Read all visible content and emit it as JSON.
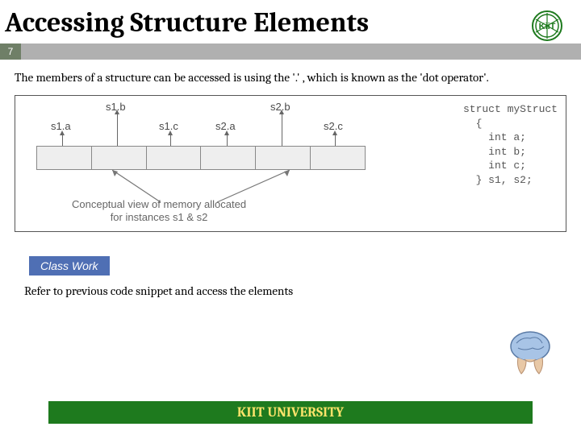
{
  "title": "Accessing Structure Elements",
  "page_number": "7",
  "intro": "The members of a structure can be accessed is using the '.' , which is known as the 'dot operator'.",
  "diagram": {
    "labels": [
      "s1.a",
      "s1.b",
      "s1.c",
      "s2.a",
      "s2.b",
      "s2.c"
    ],
    "caption_line1": "Conceptual view of memory allocated",
    "caption_line2": "for instances s1 & s2",
    "code": "struct myStruct\n  {\n    int a;\n    int b;\n    int c;\n  } s1, s2;"
  },
  "class_work_label": "Class Work",
  "refer_text": "Refer to previous code snippet and access the elements",
  "footer": "KIIT UNIVERSITY",
  "logo_text": "KiiT"
}
